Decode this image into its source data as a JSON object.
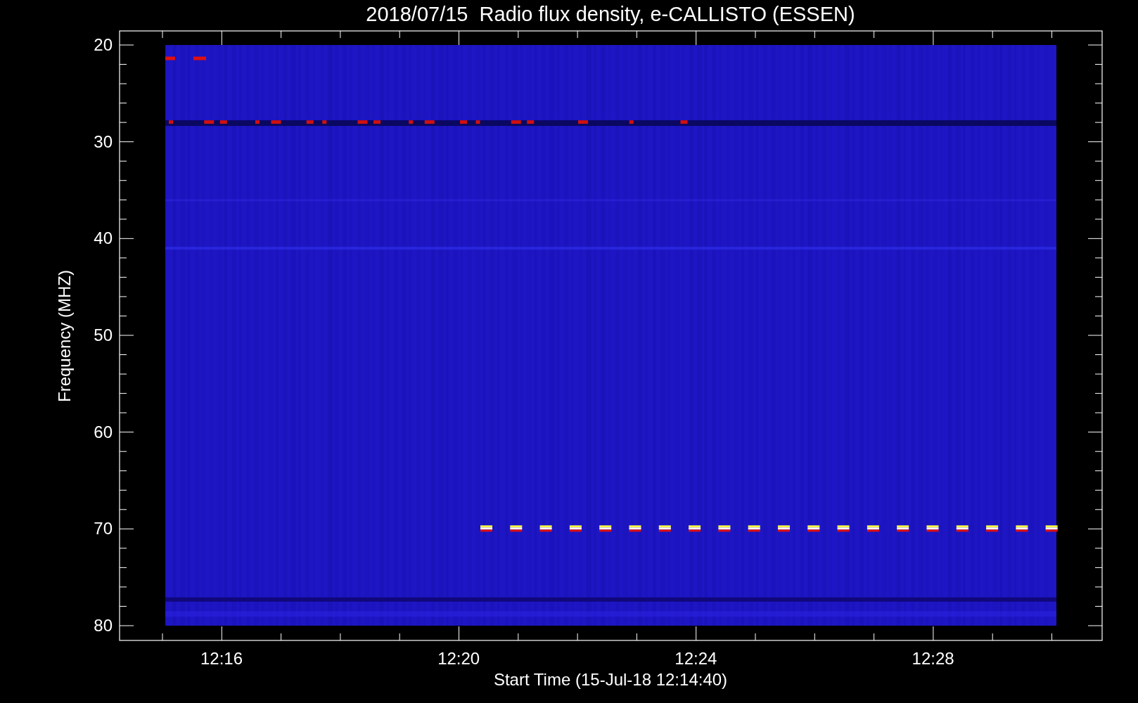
{
  "title": "2018/07/15  Radio flux density, e-CALLISTO (ESSEN)",
  "y_axis": {
    "label": "Frequency (MHZ)",
    "ticks": [
      "20",
      "30",
      "40",
      "50",
      "60",
      "70",
      "80"
    ]
  },
  "x_axis": {
    "label": "Start Time (15-Jul-18 12:14:40)",
    "ticks": [
      "12:16",
      "12:20",
      "12:24",
      "12:28"
    ]
  }
}
